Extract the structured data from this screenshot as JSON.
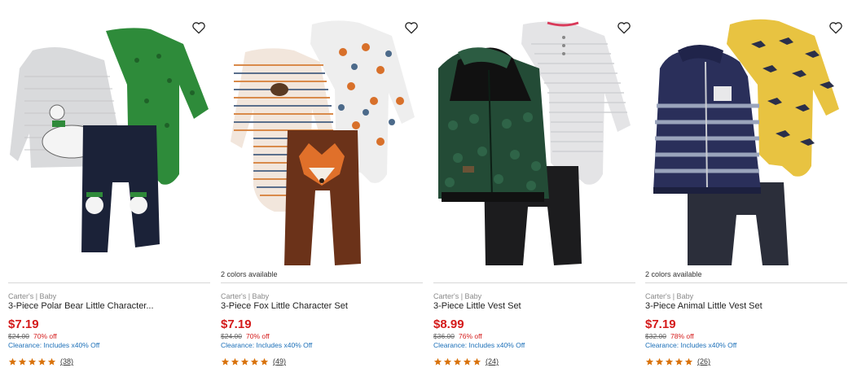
{
  "products": [
    {
      "colors_available": "",
      "brand": "Carter's | Baby",
      "title": "3-Piece Polar Bear Little Character...",
      "price": "$7.19",
      "original_price": "$24.00",
      "discount": "70% off",
      "clearance": "Clearance: Includes x40% Off",
      "rating": 5,
      "review_count": "(38)",
      "image_icon": "polar-bear-outfit",
      "favorite_icon": "heart-outline-icon"
    },
    {
      "colors_available": "2 colors available",
      "brand": "Carter's | Baby",
      "title": "3-Piece Fox Little Character Set",
      "price": "$7.19",
      "original_price": "$24.00",
      "discount": "70% off",
      "clearance": "Clearance: Includes x40% Off",
      "rating": 5,
      "review_count": "(49)",
      "image_icon": "fox-outfit",
      "favorite_icon": "heart-outline-icon"
    },
    {
      "colors_available": "",
      "brand": "Carter's | Baby",
      "title": "3-Piece Little Vest Set",
      "price": "$8.99",
      "original_price": "$36.00",
      "discount": "76% off",
      "clearance": "Clearance: Includes x40% Off",
      "rating": 5,
      "review_count": "(24)",
      "image_icon": "green-vest-outfit",
      "favorite_icon": "heart-outline-icon"
    },
    {
      "colors_available": "2 colors available",
      "brand": "Carter's | Baby",
      "title": "3-Piece Animal Little Vest Set",
      "price": "$7.19",
      "original_price": "$32.00",
      "discount": "78% off",
      "clearance": "Clearance: Includes x40% Off",
      "rating": 5,
      "review_count": "(26)",
      "image_icon": "navy-vest-outfit",
      "favorite_icon": "heart-outline-icon"
    }
  ],
  "colors": {
    "price_red": "#d41a1a",
    "clearance_blue": "#1b6fb8",
    "star_orange": "#d9730d"
  }
}
